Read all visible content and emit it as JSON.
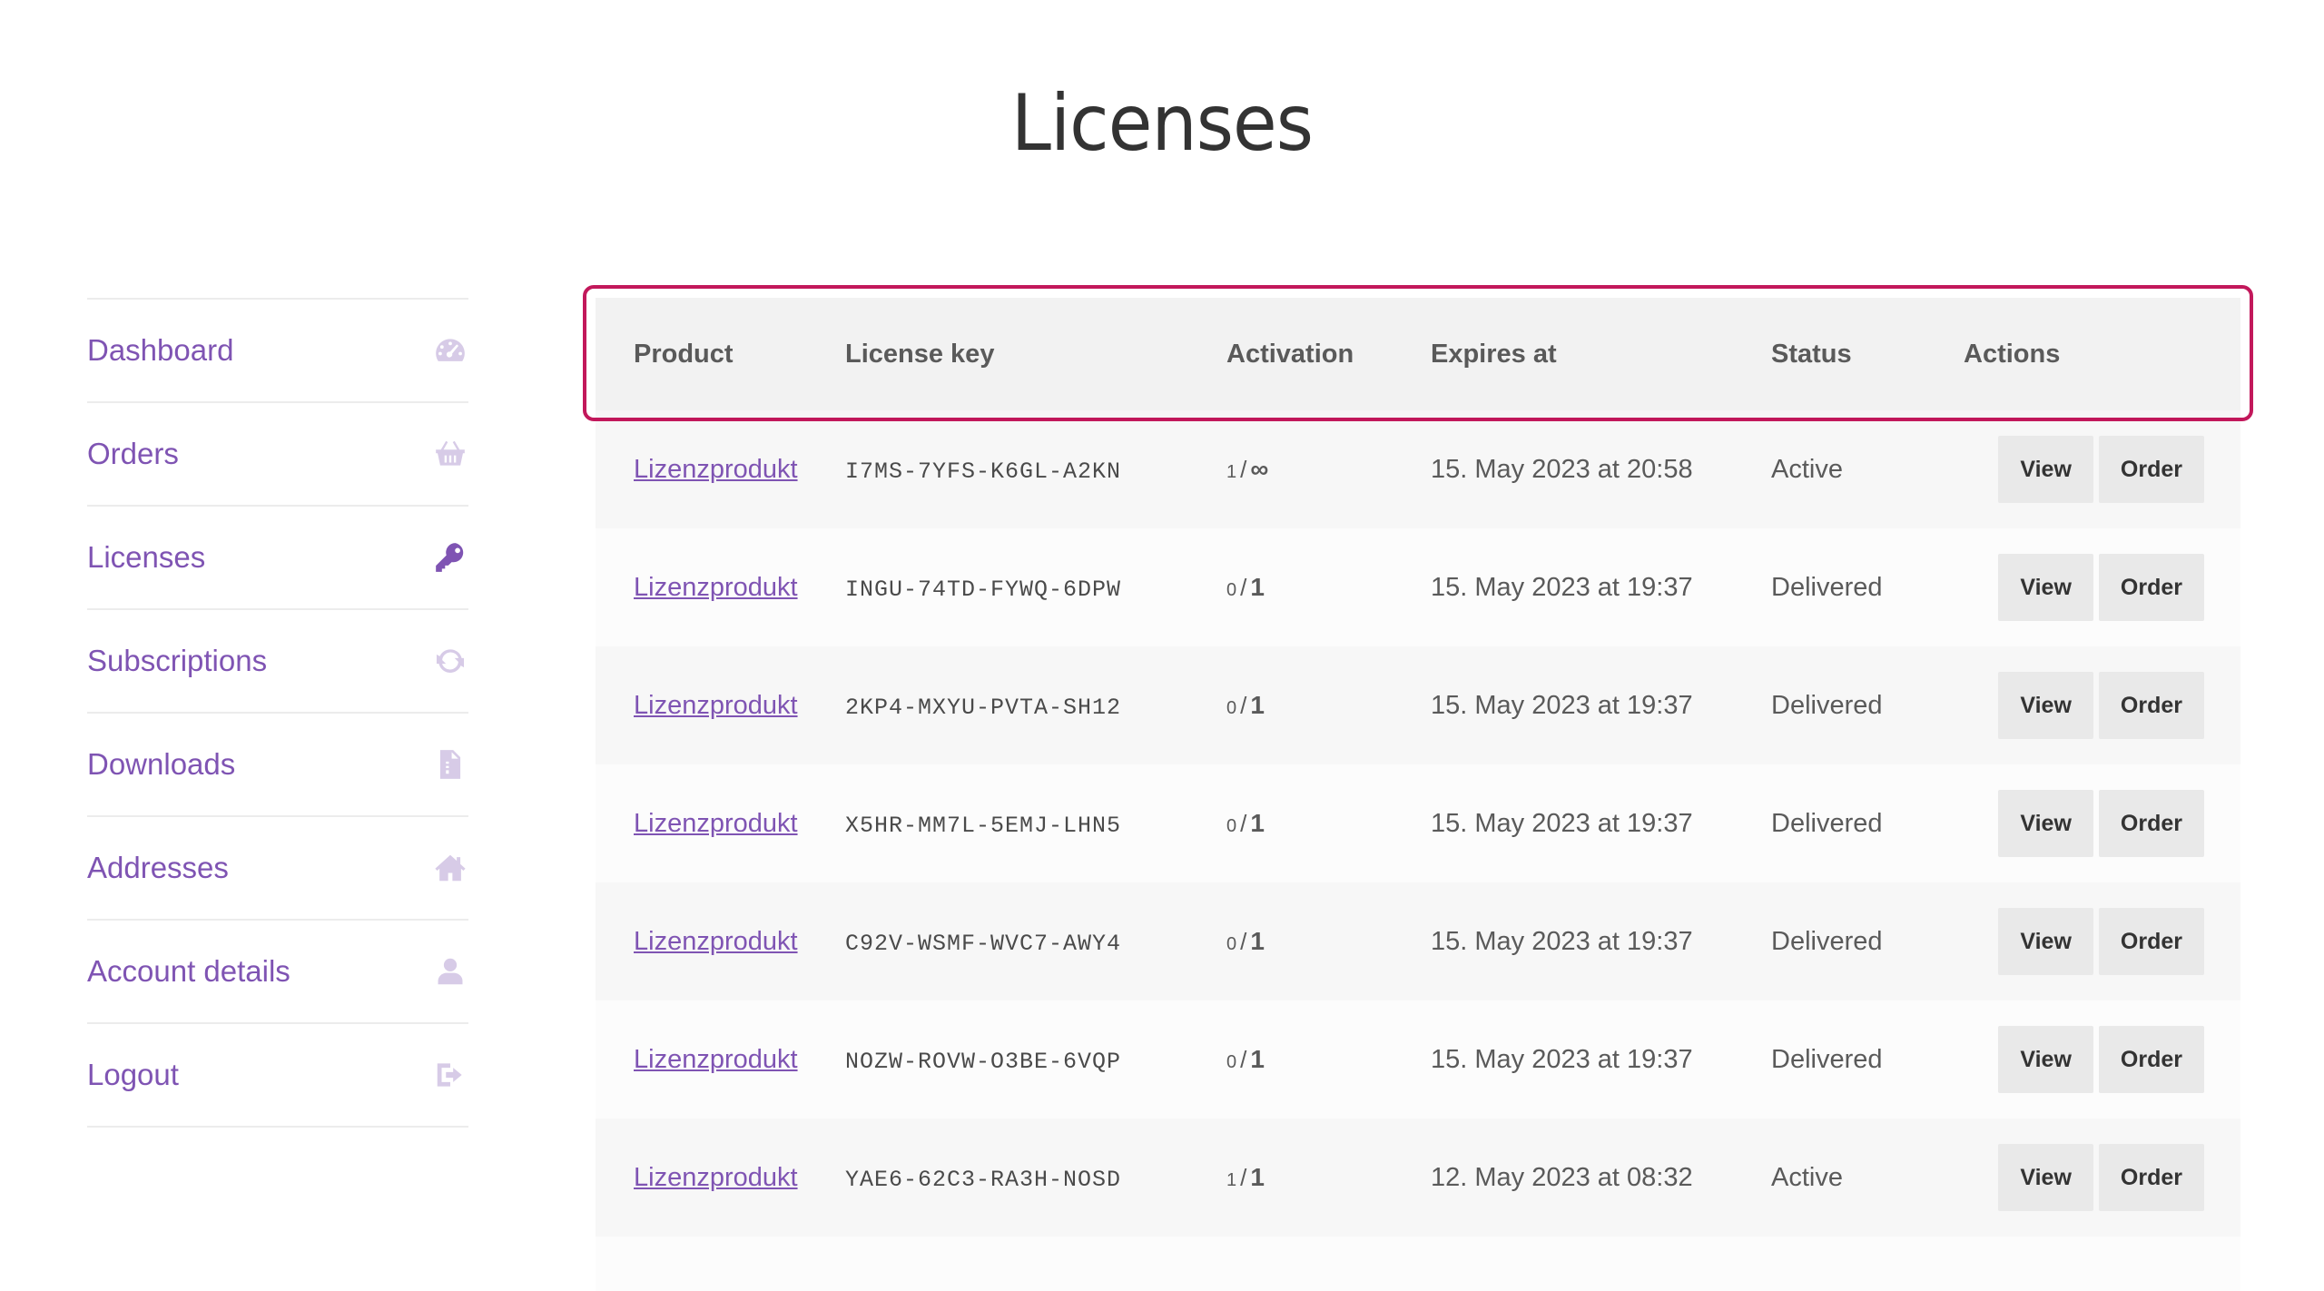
{
  "page": {
    "title": "Licenses"
  },
  "sidebar": {
    "items": [
      {
        "label": "Dashboard",
        "icon": "dashboard-icon",
        "active": false
      },
      {
        "label": "Orders",
        "icon": "basket-icon",
        "active": false
      },
      {
        "label": "Licenses",
        "icon": "key-icon",
        "active": true
      },
      {
        "label": "Subscriptions",
        "icon": "refresh-icon",
        "active": false
      },
      {
        "label": "Downloads",
        "icon": "file-icon",
        "active": false
      },
      {
        "label": "Addresses",
        "icon": "home-icon",
        "active": false
      },
      {
        "label": "Account details",
        "icon": "user-icon",
        "active": false
      },
      {
        "label": "Logout",
        "icon": "logout-icon",
        "active": false
      }
    ]
  },
  "table": {
    "headers": {
      "product": "Product",
      "license_key": "License key",
      "activation": "Activation",
      "expires": "Expires at",
      "status": "Status",
      "actions": "Actions"
    },
    "rows": [
      {
        "product": "Lizenzprodukt",
        "key": "I7MS-7YFS-K6GL-A2KN",
        "used": "1",
        "sep": "/",
        "max": "∞",
        "expires": "15. May 2023 at 20:58",
        "status": "Active",
        "view": "View",
        "order": "Order"
      },
      {
        "product": "Lizenzprodukt",
        "key": "INGU-74TD-FYWQ-6DPW",
        "used": "0",
        "sep": "/",
        "max": "1",
        "expires": "15. May 2023 at 19:37",
        "status": "Delivered",
        "view": "View",
        "order": "Order"
      },
      {
        "product": "Lizenzprodukt",
        "key": "2KP4-MXYU-PVTA-SH12",
        "used": "0",
        "sep": "/",
        "max": "1",
        "expires": "15. May 2023 at 19:37",
        "status": "Delivered",
        "view": "View",
        "order": "Order"
      },
      {
        "product": "Lizenzprodukt",
        "key": "X5HR-MM7L-5EMJ-LHN5",
        "used": "0",
        "sep": "/",
        "max": "1",
        "expires": "15. May 2023 at 19:37",
        "status": "Delivered",
        "view": "View",
        "order": "Order"
      },
      {
        "product": "Lizenzprodukt",
        "key": "C92V-WSMF-WVC7-AWY4",
        "used": "0",
        "sep": "/",
        "max": "1",
        "expires": "15. May 2023 at 19:37",
        "status": "Delivered",
        "view": "View",
        "order": "Order"
      },
      {
        "product": "Lizenzprodukt",
        "key": "NOZW-ROVW-O3BE-6VQP",
        "used": "0",
        "sep": "/",
        "max": "1",
        "expires": "15. May 2023 at 19:37",
        "status": "Delivered",
        "view": "View",
        "order": "Order"
      },
      {
        "product": "Lizenzprodukt",
        "key": "YAE6-62C3-RA3H-NOSD",
        "used": "1",
        "sep": "/",
        "max": "1",
        "expires": "12. May 2023 at 08:32",
        "status": "Active",
        "view": "View",
        "order": "Order"
      }
    ]
  },
  "colors": {
    "accent": "#7f54b3",
    "highlight": "#c2185b",
    "icon_muted": "#d7cbe7"
  }
}
